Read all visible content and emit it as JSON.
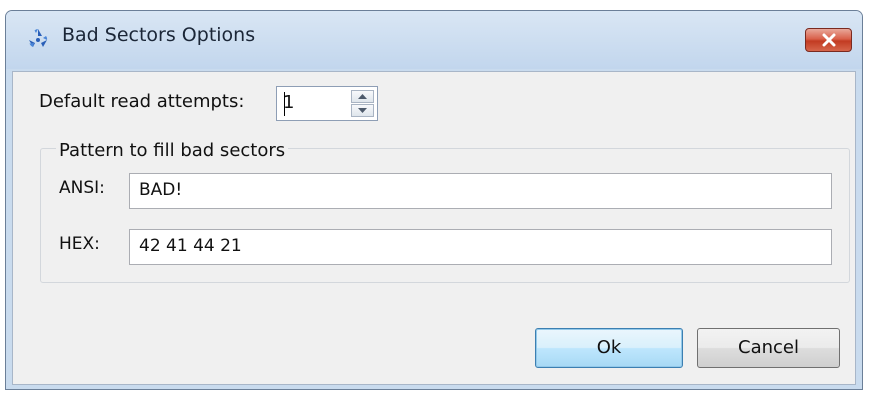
{
  "window": {
    "title": "Bad Sectors Options",
    "title_icon": "recycle-icon",
    "close_icon": "close-icon"
  },
  "read_attempts": {
    "label": "Default read attempts:",
    "value": "1"
  },
  "pattern_group": {
    "title": "Pattern to fill bad sectors",
    "ansi_label": "ANSI:",
    "ansi_value": "BAD!",
    "hex_label": "HEX:",
    "hex_value": "42 41 44 21"
  },
  "buttons": {
    "ok": "Ok",
    "cancel": "Cancel"
  },
  "colors": {
    "titlebar": "#c9dbee",
    "client_background": "#f0f0f0",
    "close_button": "#c23b22",
    "default_button_border": "#3c7fb1"
  }
}
